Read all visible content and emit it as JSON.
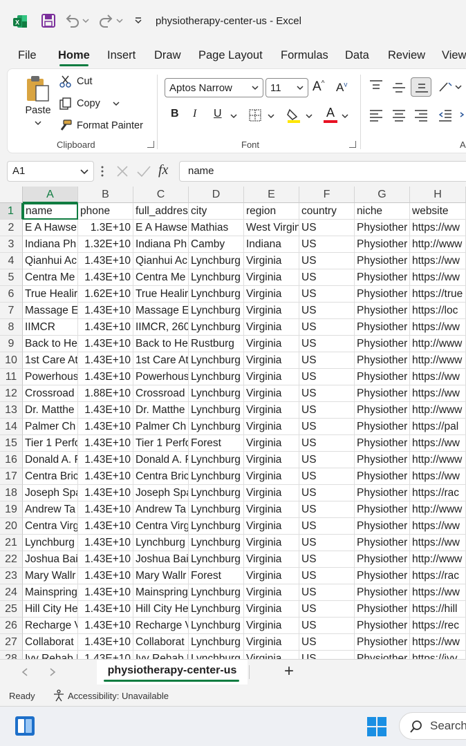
{
  "window": {
    "title": "physiotherapy-center-us  -  Excel",
    "colors": {
      "accent": "#107c41",
      "save": "#7b2f9b"
    }
  },
  "quick_access": {
    "icons": [
      "excel-logo-icon",
      "save-icon",
      "undo-icon",
      "redo-icon",
      "customize-qat-icon"
    ]
  },
  "ribbon": {
    "tabs": [
      {
        "label": "File"
      },
      {
        "label": "Home"
      },
      {
        "label": "Insert"
      },
      {
        "label": "Draw"
      },
      {
        "label": "Page Layout"
      },
      {
        "label": "Formulas"
      },
      {
        "label": "Data"
      },
      {
        "label": "Review"
      },
      {
        "label": "View"
      }
    ],
    "active_tab": "Home",
    "clipboard": {
      "paste_label": "Paste",
      "cut_label": "Cut",
      "copy_label": "Copy",
      "format_painter_label": "Format Painter",
      "group_label": "Clipboard"
    },
    "font": {
      "font_name": "Aptos Narrow",
      "font_size": "11",
      "group_label": "Font",
      "bold": "B",
      "italic": "I",
      "underline": "U",
      "font_color": "A"
    },
    "alignment": {
      "group_label_fragment": "A"
    }
  },
  "formula_bar": {
    "name_box": "A1",
    "fx_label": "fx",
    "content": "name"
  },
  "sheet": {
    "columns": [
      "A",
      "B",
      "C",
      "D",
      "E",
      "F",
      "G",
      "H"
    ],
    "rows": [
      {
        "n": "1",
        "cells": [
          "name",
          "phone",
          "full_address",
          "city",
          "region",
          "country",
          "niche",
          "website"
        ]
      },
      {
        "n": "2",
        "cells": [
          "E A Hawse",
          "1.3E+10",
          "E A Hawse",
          "Mathias",
          "West Virgini",
          "US",
          "Physiother",
          "https://ww"
        ]
      },
      {
        "n": "3",
        "cells": [
          "Indiana Ph",
          "1.32E+10",
          "Indiana Ph",
          "Camby",
          "Indiana",
          "US",
          "Physiother",
          "http://www"
        ]
      },
      {
        "n": "4",
        "cells": [
          "Qianhui Ac",
          "1.43E+10",
          "Qianhui Ac",
          "Lynchburg",
          "Virginia",
          "US",
          "Physiother",
          "https://ww"
        ]
      },
      {
        "n": "5",
        "cells": [
          "Centra Me",
          "1.43E+10",
          "Centra Me",
          "Lynchburg",
          "Virginia",
          "US",
          "Physiother",
          "https://ww"
        ]
      },
      {
        "n": "6",
        "cells": [
          "True Healir",
          "1.62E+10",
          "True Healir",
          "Lynchburg",
          "Virginia",
          "US",
          "Physiother",
          "https://true"
        ]
      },
      {
        "n": "7",
        "cells": [
          "Massage E",
          "1.43E+10",
          "Massage E",
          "Lynchburg",
          "Virginia",
          "US",
          "Physiother",
          "https://loc"
        ]
      },
      {
        "n": "8",
        "cells": [
          "IIMCR",
          "1.43E+10",
          "IIMCR, 260",
          "Lynchburg",
          "Virginia",
          "US",
          "Physiother",
          "https://ww"
        ]
      },
      {
        "n": "9",
        "cells": [
          "Back to He",
          "1.43E+10",
          "Back to He",
          "Rustburg",
          "Virginia",
          "US",
          "Physiother",
          "http://www"
        ]
      },
      {
        "n": "10",
        "cells": [
          "1st Care At",
          "1.43E+10",
          "1st Care At",
          "Lynchburg",
          "Virginia",
          "US",
          "Physiother",
          "http://www"
        ]
      },
      {
        "n": "11",
        "cells": [
          "Powerhous",
          "1.43E+10",
          "Powerhous",
          "Lynchburg",
          "Virginia",
          "US",
          "Physiother",
          "https://ww"
        ]
      },
      {
        "n": "12",
        "cells": [
          "Crossroad",
          "1.88E+10",
          "Crossroad",
          "Lynchburg",
          "Virginia",
          "US",
          "Physiother",
          "https://ww"
        ]
      },
      {
        "n": "13",
        "cells": [
          "Dr. Matthe",
          "1.43E+10",
          "Dr. Matthe",
          "Lynchburg",
          "Virginia",
          "US",
          "Physiother",
          "http://www"
        ]
      },
      {
        "n": "14",
        "cells": [
          "Palmer Ch",
          "1.43E+10",
          "Palmer Ch",
          "Lynchburg",
          "Virginia",
          "US",
          "Physiother",
          "https://pal"
        ]
      },
      {
        "n": "15",
        "cells": [
          "Tier 1 Perfo",
          "1.43E+10",
          "Tier 1 Perfo",
          "Forest",
          "Virginia",
          "US",
          "Physiother",
          "https://ww"
        ]
      },
      {
        "n": "16",
        "cells": [
          "Donald A. F",
          "1.43E+10",
          "Donald A. F",
          "Lynchburg",
          "Virginia",
          "US",
          "Physiother",
          "http://www"
        ]
      },
      {
        "n": "17",
        "cells": [
          "Centra Bric",
          "1.43E+10",
          "Centra Bric",
          "Lynchburg",
          "Virginia",
          "US",
          "Physiother",
          "https://ww"
        ]
      },
      {
        "n": "18",
        "cells": [
          "Joseph Spa",
          "1.43E+10",
          "Joseph Spa",
          "Lynchburg",
          "Virginia",
          "US",
          "Physiother",
          "https://rac"
        ]
      },
      {
        "n": "19",
        "cells": [
          "Andrew Ta",
          "1.43E+10",
          "Andrew Ta",
          "Lynchburg",
          "Virginia",
          "US",
          "Physiother",
          "http://www"
        ]
      },
      {
        "n": "20",
        "cells": [
          "Centra Virg",
          "1.43E+10",
          "Centra Virg",
          "Lynchburg",
          "Virginia",
          "US",
          "Physiother",
          "https://ww"
        ]
      },
      {
        "n": "21",
        "cells": [
          "Lynchburg",
          "1.43E+10",
          "Lynchburg",
          "Lynchburg",
          "Virginia",
          "US",
          "Physiother",
          "https://ww"
        ]
      },
      {
        "n": "22",
        "cells": [
          "Joshua Bai",
          "1.43E+10",
          "Joshua Bai",
          "Lynchburg",
          "Virginia",
          "US",
          "Physiother",
          "http://www"
        ]
      },
      {
        "n": "23",
        "cells": [
          "Mary Wallr",
          "1.43E+10",
          "Mary Wallr",
          "Forest",
          "Virginia",
          "US",
          "Physiother",
          "https://rac"
        ]
      },
      {
        "n": "24",
        "cells": [
          "Mainspring",
          "1.43E+10",
          "Mainspring",
          "Lynchburg",
          "Virginia",
          "US",
          "Physiother",
          "https://ww"
        ]
      },
      {
        "n": "25",
        "cells": [
          "Hill City He",
          "1.43E+10",
          "Hill City He",
          "Lynchburg",
          "Virginia",
          "US",
          "Physiother",
          "https://hill"
        ]
      },
      {
        "n": "26",
        "cells": [
          "Recharge V",
          "1.43E+10",
          "Recharge V",
          "Lynchburg",
          "Virginia",
          "US",
          "Physiother",
          "https://rec"
        ]
      },
      {
        "n": "27",
        "cells": [
          "Collaborat",
          "1.43E+10",
          "Collaborat",
          "Lynchburg",
          "Virginia",
          "US",
          "Physiother",
          "https://ww"
        ]
      },
      {
        "n": "28",
        "cells": [
          "Ivy Rehab F",
          "1.43E+10",
          "Ivy Rehab F",
          "Lynchburg",
          "Virginia",
          "US",
          "Physiother",
          "https://ivy"
        ]
      }
    ],
    "active_cell": "A1"
  },
  "sheet_tabs": {
    "tabs": [
      {
        "label": "physiotherapy-center-us"
      }
    ],
    "add_label": "+"
  },
  "status": {
    "ready": "Ready",
    "accessibility": "Accessibility: Unavailable"
  },
  "taskbar": {
    "search_label": "Search"
  }
}
